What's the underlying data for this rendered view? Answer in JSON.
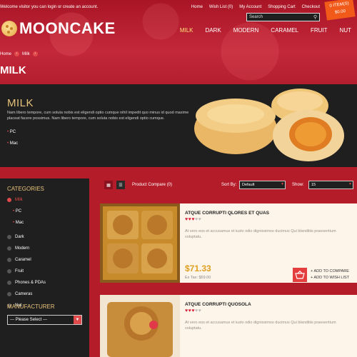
{
  "topbar": {
    "welcome_text": "Welcome visitor you can login or create an account.",
    "links": [
      "Home",
      "Wish List (0)",
      "My Account",
      "Shopping Cart",
      "Checkout"
    ],
    "search_placeholder": "Search",
    "cart_items": "0 ITEM(S)",
    "cart_total": "$0.00"
  },
  "logo": {
    "name": "MOONCAKE"
  },
  "nav": {
    "items": [
      "MILK",
      "DARK",
      "MODERN",
      "CARAMEL",
      "FRUIT",
      "NUT"
    ],
    "active": "MILK"
  },
  "breadcrumb": {
    "items": [
      "Home",
      "Milk"
    ]
  },
  "page_title": "MILK",
  "hero": {
    "heading": "MILK",
    "description": "Nam libero tempore, cum soluta nobis est eligendi optio cumque nihil impedit quo minus id quod maxime placeat facere possimus. Nam libero tempore, cum soluta nobis est eligendi optio cumque.",
    "subcategories": [
      "PC",
      "Mac"
    ]
  },
  "sidebar": {
    "categories_title": "CATEGORIES",
    "categories": [
      {
        "label": "Milk",
        "active": true,
        "children": [
          "PC",
          "Mac"
        ]
      },
      {
        "label": "Dark"
      },
      {
        "label": "Modern"
      },
      {
        "label": "Caramel"
      },
      {
        "label": "Fruit"
      },
      {
        "label": "Phones & PDAs"
      },
      {
        "label": "Cameras"
      },
      {
        "label": "Nut"
      }
    ],
    "manufacturer_title": "MANUFACTURER",
    "manufacturer_select": "--- Please Select ---"
  },
  "toolbar": {
    "product_compare": "Product Compare (0)",
    "sort_label": "Sort By:",
    "sort_value": "Default",
    "show_label": "Show:",
    "show_value": "15"
  },
  "products": [
    {
      "title": "ATQUE CORRUPTI QLORES ET QUAS",
      "rating": 3,
      "description": "At vero eos et accusamus et iusto odio dignissimos ducimus Qui blanditiis praesentium voluptatu.",
      "price": "$71.33",
      "ex_tax": "Ex Tax: $59.00",
      "add_to_compare": "ADD TO COMPARE",
      "add_to_wishlist": "ADD TO WISH LIST"
    },
    {
      "title": "ATQUE CORRUPTI QUOSOLA",
      "rating": 3,
      "description": "At vero eos et accusamus et iusto odio dignissimos ducimus Qui blanditiis praesentium voluptatu."
    }
  ],
  "colors": {
    "brand_red": "#b51c2a",
    "accent_gold": "#e8c37a",
    "panel_dark": "#1f1f1f",
    "price": "#e0a020"
  }
}
